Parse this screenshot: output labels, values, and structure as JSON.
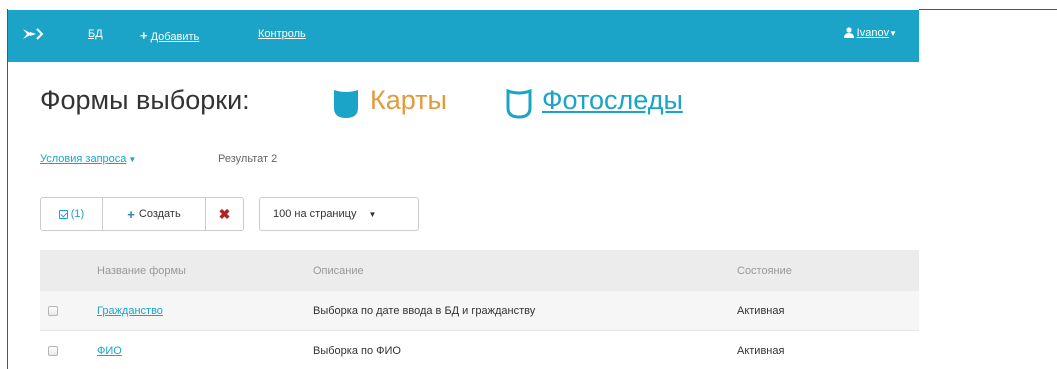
{
  "navbar": {
    "bd_label": "БД",
    "add_label": "Добавить",
    "control_label": "Контроль",
    "user_label": "Ivanov"
  },
  "page": {
    "title": "Формы выборки:",
    "cards_label": "Карты",
    "photo_label": "Фотоследы"
  },
  "query": {
    "conditions_label": "Условия запроса",
    "result_label": "Результат 2"
  },
  "toolbar": {
    "select_count": "(1)",
    "create_label": "Создать",
    "per_page_label": "100 на страницу"
  },
  "table": {
    "headers": {
      "name": "Название формы",
      "description": "Описание",
      "state": "Состояние"
    },
    "rows": [
      {
        "name": "Гражданство",
        "description": "Выборка по дате ввода в БД и гражданству",
        "state": "Активная"
      },
      {
        "name": "ФИО",
        "description": "Выборка по ФИО",
        "state": "Активная"
      }
    ]
  },
  "colors": {
    "navbar": "#1ba4c8",
    "accent_orange": "#e39a3c",
    "link": "#1ba4c8",
    "delete": "#b32222"
  },
  "icons": {
    "logo": "bird-logo-icon",
    "add": "plus-icon",
    "user": "user-icon",
    "cards": "cards-shape-icon",
    "photo": "photo-shape-icon",
    "select_all": "checkbox-icon",
    "create": "plus-icon",
    "delete": "close-icon",
    "caret": "caret-down-icon"
  }
}
